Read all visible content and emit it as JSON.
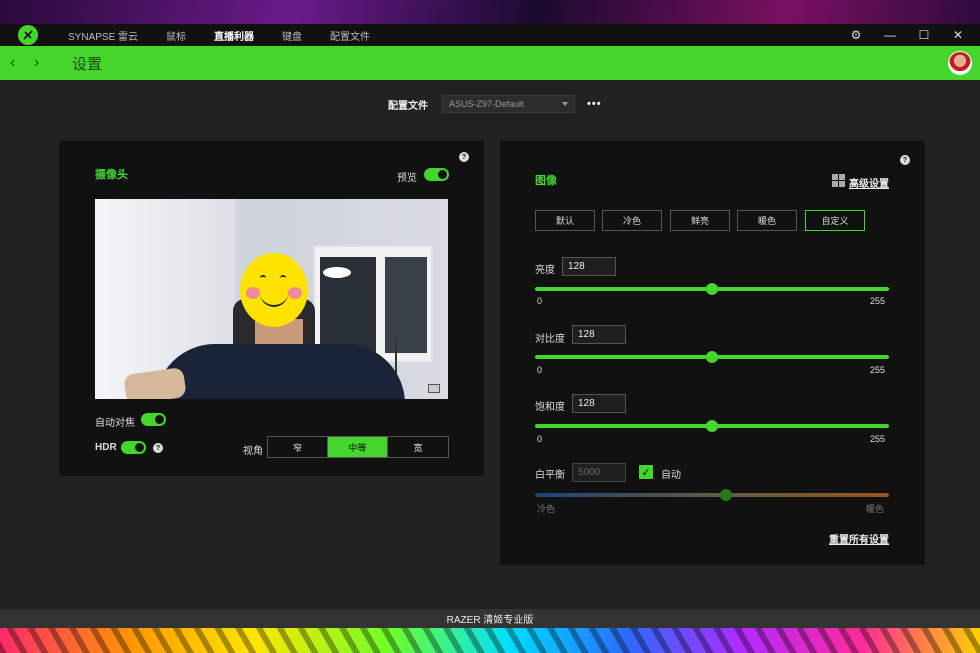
{
  "nav": {
    "items": [
      {
        "label": "SYNAPSE 雷云"
      },
      {
        "label": "鼠标"
      },
      {
        "label": "直播利器"
      },
      {
        "label": "键盘"
      },
      {
        "label": "配置文件"
      }
    ],
    "active_index": 2
  },
  "window_controls": {
    "settings_icon": "⚙",
    "minimize": "—",
    "maximize": "☐",
    "close": "✕"
  },
  "header": {
    "back": "‹",
    "forward": "›",
    "title": "设置"
  },
  "profile": {
    "label": "配置文件",
    "value": "ASUS-Z97-Default",
    "more": "•••"
  },
  "camera_panel": {
    "title": "摄像头",
    "help": "?",
    "preview_label": "预览",
    "preview_on": true,
    "autofocus_label": "自动对焦",
    "autofocus_on": true,
    "hdr_label": "HDR",
    "hdr_on": true,
    "hdr_help": "?",
    "fov_label": "视角",
    "fov_options": [
      "窄",
      "中等",
      "宽"
    ],
    "fov_selected": "中等"
  },
  "image_panel": {
    "title": "图像",
    "help": "?",
    "advanced_link": "高级设置",
    "presets": [
      "默认",
      "冷色",
      "鲜亮",
      "暖色",
      "自定义"
    ],
    "preset_selected": "自定义",
    "brightness": {
      "label": "亮度",
      "value": "128",
      "min": "0",
      "max": "255"
    },
    "contrast": {
      "label": "对比度",
      "value": "128",
      "min": "0",
      "max": "255"
    },
    "saturation": {
      "label": "饱和度",
      "value": "128",
      "min": "0",
      "max": "255"
    },
    "white_balance": {
      "label": "白平衡",
      "value": "5000",
      "auto_label": "自动",
      "auto_checked": true,
      "min_label": "冷色",
      "max_label": "暖色",
      "level": 0.54
    },
    "reset_link": "重置所有设置"
  },
  "footer": {
    "text": "RAZER 清姬专业版"
  },
  "colors": {
    "accent": "#44d62c",
    "panel": "#111111",
    "background": "#222222"
  }
}
